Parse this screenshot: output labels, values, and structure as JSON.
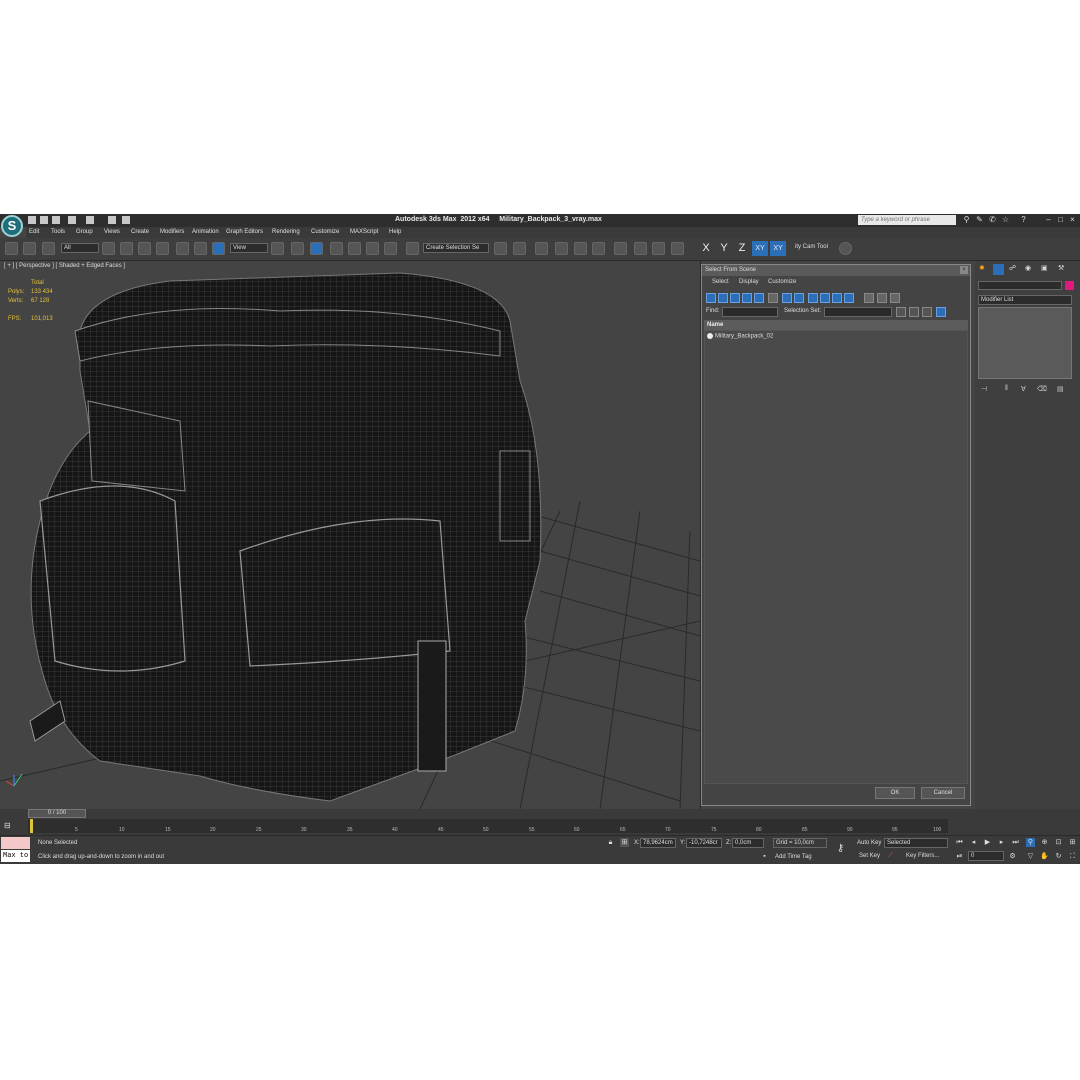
{
  "window": {
    "title": "Autodesk 3ds Max  2012 x64     Military_Backpack_3_vray.max",
    "search_placeholder": "Type a keyword or phrase"
  },
  "menu": [
    "Edit",
    "Tools",
    "Group",
    "Views",
    "Create",
    "Modifiers",
    "Animation",
    "Graph Editors",
    "Rendering",
    "Customize",
    "MAXScript",
    "Help"
  ],
  "toolbar": {
    "selection_filter": "All",
    "ref_coord": "View",
    "named_selection": "Create Selection Se",
    "axes": [
      "X",
      "Y",
      "Z",
      "XY",
      "XY"
    ],
    "cam_tool": "ity Cam Tool"
  },
  "viewport": {
    "label": "[ + ] [ Perspective ] [ Shaded + Edged Faces ]",
    "stats_header": "Total",
    "stats": [
      {
        "label": "Polys:",
        "value": "133 434"
      },
      {
        "label": "Verts:",
        "value": "67 128"
      },
      {
        "label": "FPS:",
        "value": "101,013"
      }
    ]
  },
  "dialog": {
    "title": "Select From Scene",
    "menu": [
      "Select",
      "Display",
      "Customize"
    ],
    "find_label": "Find:",
    "selection_set_label": "Selection Set:",
    "column_name": "Name",
    "items": [
      "Military_Backpack_02"
    ],
    "ok": "OK",
    "cancel": "Cancel"
  },
  "command_panel": {
    "modifier_list": "Modifier List"
  },
  "timeline": {
    "slider": "0 / 100",
    "ticks": [
      "0",
      "5",
      "10",
      "15",
      "20",
      "25",
      "30",
      "35",
      "40",
      "45",
      "50",
      "55",
      "60",
      "65",
      "70",
      "75",
      "80",
      "85",
      "90",
      "95",
      "100"
    ]
  },
  "status": {
    "maxscript": "Max to",
    "selection": "None Selected",
    "prompt": "Click and drag up-and-down to zoom in and out",
    "x_label": "X:",
    "x_value": "78,9624cm",
    "y_label": "Y:",
    "y_value": "-10,7248cr",
    "z_label": "Z:",
    "z_value": "0,0cm",
    "grid": "Grid = 10,0cm",
    "add_time_tag": "Add Time Tag",
    "auto_key": "Auto Key",
    "set_key": "Set Key",
    "key_mode": "Selected",
    "key_filters": "Key Filters...",
    "frame": "0"
  },
  "colors": {
    "accent": "#2b6fb8",
    "stats_text": "#e2c23a",
    "background": "#444444"
  }
}
